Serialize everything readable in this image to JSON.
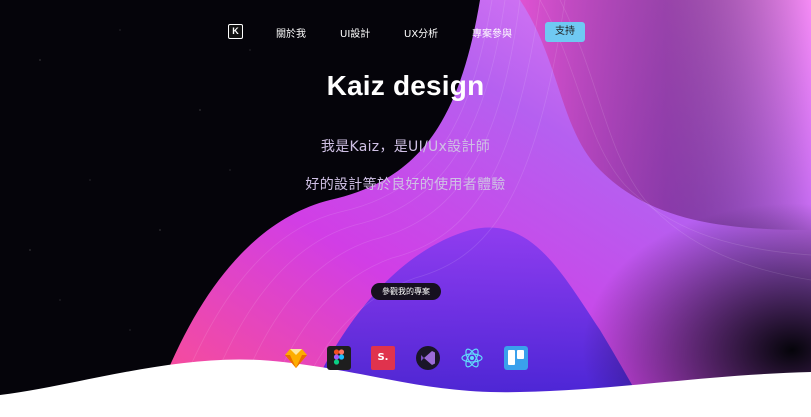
{
  "nav": {
    "logo_letter": "K",
    "items": [
      "關於我",
      "UI設計",
      "UX分析",
      "專案參與"
    ],
    "support_label": "支持"
  },
  "hero": {
    "title": "Kaiz design",
    "subtitle_line1": "我是Kaiz，是UI/Ux設計師",
    "subtitle_line2": "好的設計等於良好的使用者體驗",
    "cta_label": "參觀我的專案"
  },
  "tools": [
    {
      "icon": "sketch-icon"
    },
    {
      "icon": "figma-icon"
    },
    {
      "icon": "studio-icon",
      "label": "S."
    },
    {
      "icon": "visual-studio-icon"
    },
    {
      "icon": "react-icon"
    },
    {
      "icon": "trello-icon"
    }
  ],
  "colors": {
    "background": "#05040a",
    "support_button": "#6fc9f3",
    "wave_pink": "#e84bd8",
    "wave_purple": "#5b2bd6"
  }
}
